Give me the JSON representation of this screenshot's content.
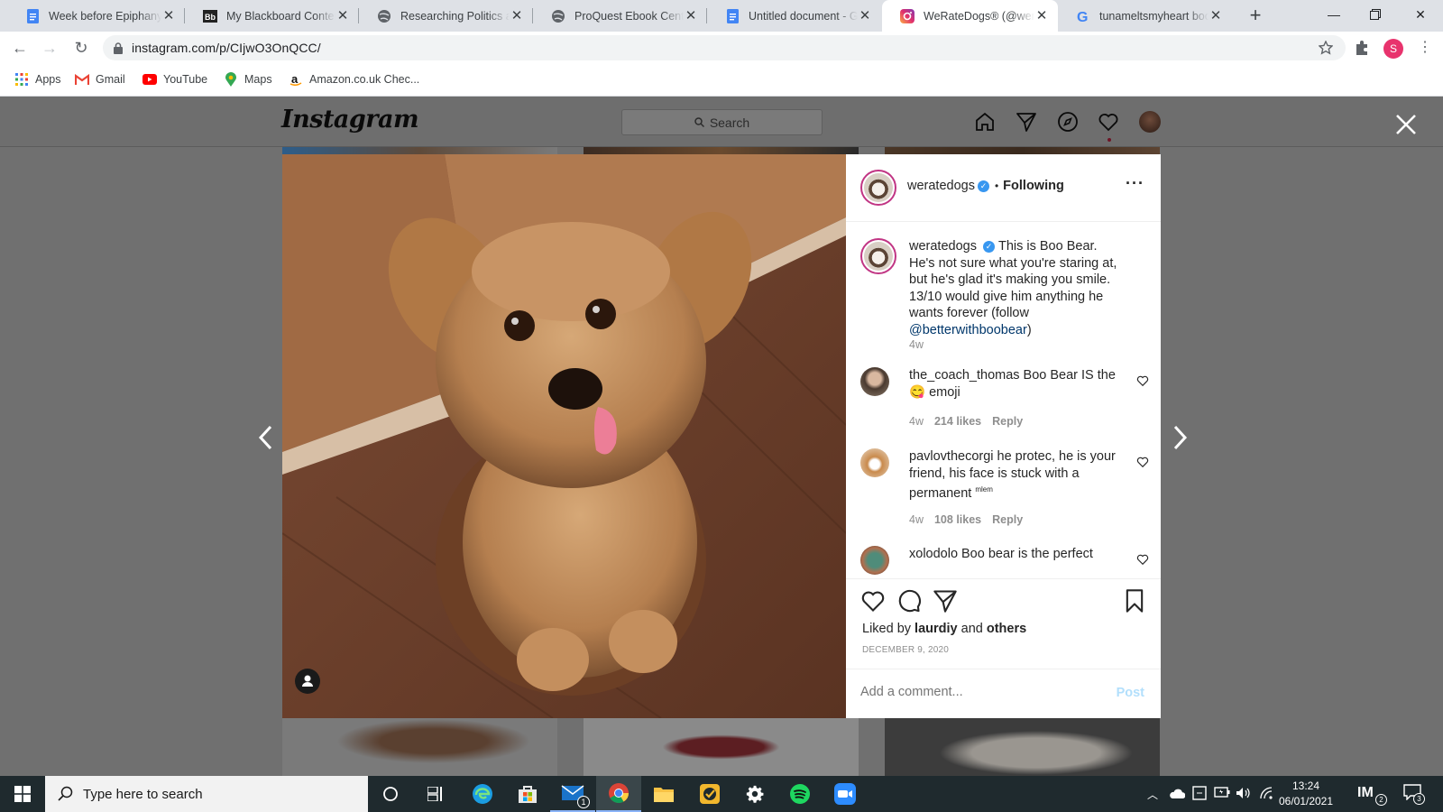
{
  "browser": {
    "tabs": [
      {
        "title": "Week before Epiphany",
        "icon": "google-docs-icon"
      },
      {
        "title": "My Blackboard Content",
        "icon": "blackboard-icon"
      },
      {
        "title": "Researching Politics and",
        "icon": "globe-icon"
      },
      {
        "title": "ProQuest Ebook Central",
        "icon": "globe-icon"
      },
      {
        "title": "Untitled document - Go",
        "icon": "google-docs-icon"
      },
      {
        "title": "WeRateDogs® (@weratedogs)",
        "icon": "instagram-icon"
      },
      {
        "title": "tunameltsmyheart boo",
        "icon": "google-icon"
      }
    ],
    "active_tab": 5,
    "url": "instagram.com/p/CIjwO3OnQCC/",
    "profile_initial": "S",
    "bookmarks": [
      {
        "label": "Apps",
        "icon": "apps-grid-icon"
      },
      {
        "label": "Gmail",
        "icon": "gmail-icon"
      },
      {
        "label": "YouTube",
        "icon": "youtube-icon"
      },
      {
        "label": "Maps",
        "icon": "maps-pin-icon"
      },
      {
        "label": "Amazon.co.uk Chec...",
        "icon": "amazon-icon"
      }
    ]
  },
  "instagram": {
    "logo": "Instagram",
    "search_placeholder": "Search",
    "post": {
      "username": "weratedogs",
      "following_label": "Following",
      "caption_pre": "This is Boo Bear. He's not sure what you're staring at, but he's glad it's making you smile. 13/10 would give him anything he wants forever (follow ",
      "caption_mention": "@betterwithboobear",
      "caption_post": ")",
      "caption_age": "4w",
      "comments": [
        {
          "username": "the_coach_thomas",
          "text_pre": "Boo Bear IS the ",
          "emoji": "😋",
          "text_post": " emoji",
          "age": "4w",
          "likes": "214 likes",
          "reply": "Reply"
        },
        {
          "username": "pavlovthecorgi",
          "text_pre": "he protec, he is your friend, his face is stuck with a permanent ",
          "sup": "mlem",
          "age": "4w",
          "likes": "108 likes",
          "reply": "Reply"
        },
        {
          "username": "xolodolo",
          "text_pre": "Boo bear is the perfect"
        }
      ],
      "liked_by_prefix": "Liked by",
      "liked_by_user": "laurdiy",
      "liked_by_and": "and",
      "liked_by_others": "others",
      "date": "DECEMBER 9, 2020",
      "add_comment_placeholder": "Add a comment...",
      "post_button": "Post"
    }
  },
  "taskbar": {
    "search_placeholder": "Type here to search",
    "time": "13:24",
    "date": "06/01/2021",
    "mail_badge": "1",
    "notif_badge": "3",
    "im_badge": "2"
  },
  "colors": {
    "instagram_link": "#00376b",
    "verified": "#3897f0",
    "post_disabled": "#b2dffc",
    "taskbar": "#1f2a2e"
  }
}
